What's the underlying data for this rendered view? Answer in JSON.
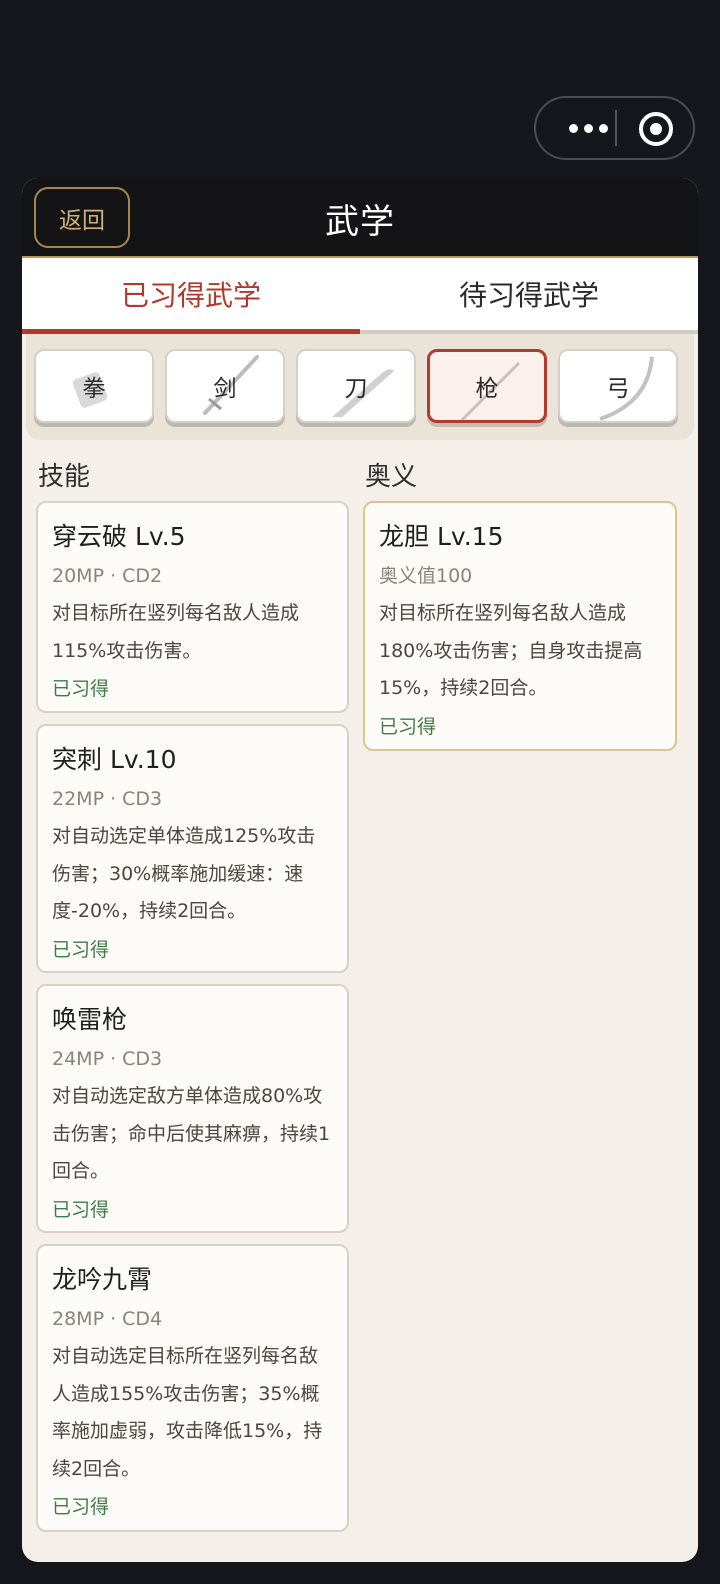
{
  "capsule": {
    "more_icon": "more-dots-icon",
    "close_icon": "target-circle-icon"
  },
  "header": {
    "back_label": "返回",
    "title": "武学"
  },
  "tabs": [
    {
      "label": "已习得武学",
      "active": true
    },
    {
      "label": "待习得武学",
      "active": false
    }
  ],
  "weapons": [
    {
      "label": "拳",
      "icon": "fist-icon"
    },
    {
      "label": "剑",
      "icon": "sword-icon"
    },
    {
      "label": "刀",
      "icon": "blade-icon"
    },
    {
      "label": "枪",
      "icon": "spear-icon",
      "active": true
    },
    {
      "label": "弓",
      "icon": "bow-icon"
    }
  ],
  "skills_heading": "技能",
  "ultimate_heading": "奥义",
  "skills": [
    {
      "name": "穿云破  Lv.5",
      "meta": "20MP  ·  CD2",
      "desc": "对目标所在竖列每名敌人造成115%攻击伤害。",
      "status": "已习得"
    },
    {
      "name": "突刺  Lv.10",
      "meta": "22MP  ·  CD3",
      "desc": "对自动选定单体造成125%攻击伤害；30%概率施加缓速：速度-20%，持续2回合。",
      "status": "已习得"
    },
    {
      "name": "唤雷枪",
      "meta": "24MP  ·  CD3",
      "desc": "对自动选定敌方单体造成80%攻击伤害；命中后使其麻痹，持续1回合。",
      "status": "已习得"
    },
    {
      "name": "龙吟九霄",
      "meta": "28MP  ·  CD4",
      "desc": "对自动选定目标所在竖列每名敌人造成155%攻击伤害；35%概率施加虚弱，攻击降低15%，持续2回合。",
      "status": "已习得"
    }
  ],
  "ultimates": [
    {
      "name": "龙胆  Lv.15",
      "meta": "奥义值100",
      "desc": "对目标所在竖列每名敌人造成180%攻击伤害；自身攻击提高15%，持续2回合。",
      "status": "已习得"
    }
  ],
  "colors": {
    "accent": "#b0392c",
    "learned": "#3f7a4a",
    "gold_border": "#dcc48a"
  }
}
